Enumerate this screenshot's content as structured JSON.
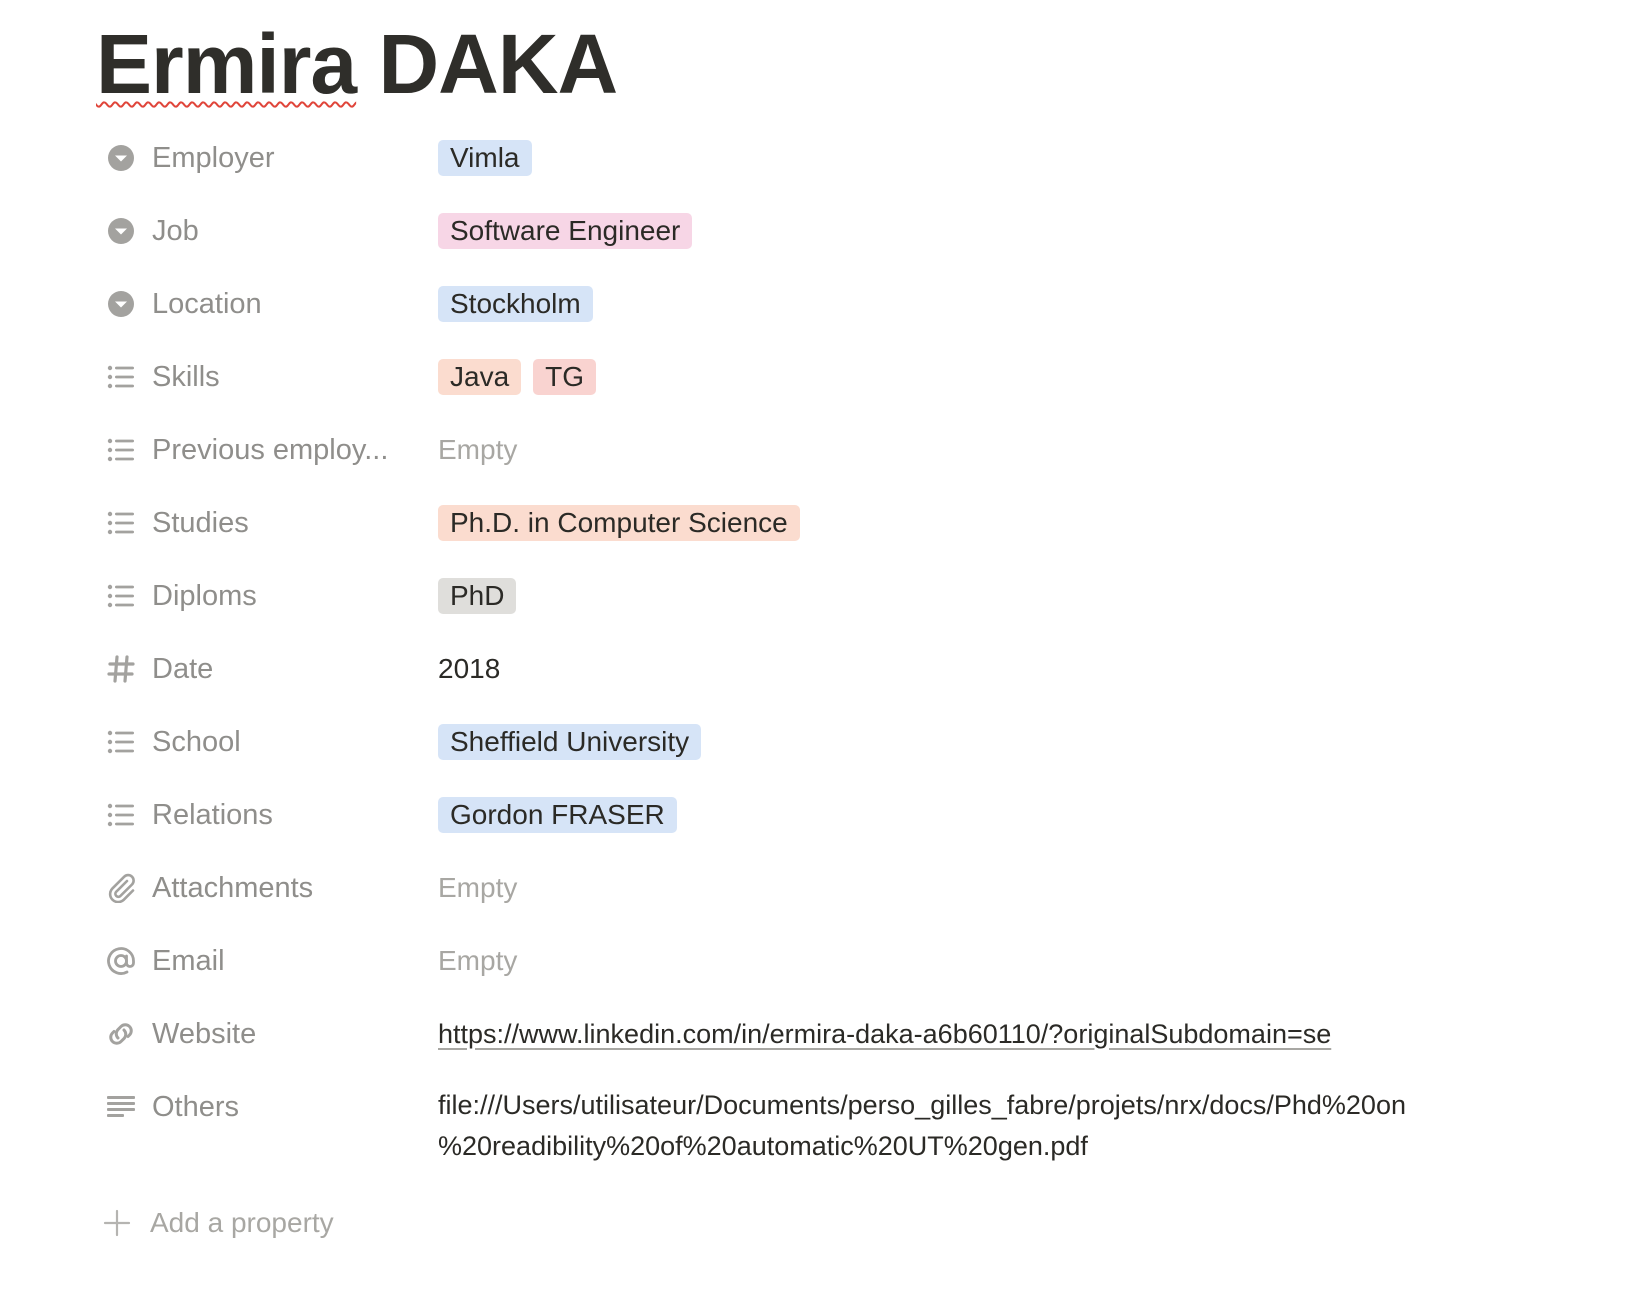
{
  "page": {
    "title_first": "Ermira",
    "title_last": "DAKA"
  },
  "properties": [
    {
      "name": "Employer",
      "icon": "select-icon",
      "type": "tags",
      "values": [
        {
          "text": "Vimla",
          "color": "blue"
        }
      ]
    },
    {
      "name": "Job",
      "icon": "select-icon",
      "type": "tags",
      "values": [
        {
          "text": "Software Engineer",
          "color": "pink"
        }
      ]
    },
    {
      "name": "Location",
      "icon": "select-icon",
      "type": "tags",
      "values": [
        {
          "text": "Stockholm",
          "color": "blue"
        }
      ]
    },
    {
      "name": "Skills",
      "icon": "multi-select-icon",
      "type": "tags",
      "values": [
        {
          "text": "Java",
          "color": "orange"
        },
        {
          "text": "TG",
          "color": "red"
        }
      ]
    },
    {
      "name": "Previous employ...",
      "icon": "multi-select-icon",
      "type": "empty",
      "empty_text": "Empty"
    },
    {
      "name": "Studies",
      "icon": "multi-select-icon",
      "type": "tags",
      "values": [
        {
          "text": "Ph.D. in Computer Science",
          "color": "orange"
        }
      ]
    },
    {
      "name": "Diploms",
      "icon": "multi-select-icon",
      "type": "tags",
      "values": [
        {
          "text": "PhD",
          "color": "gray"
        }
      ]
    },
    {
      "name": "Date",
      "icon": "number-icon",
      "type": "text",
      "text": "2018"
    },
    {
      "name": "School",
      "icon": "multi-select-icon",
      "type": "tags",
      "values": [
        {
          "text": "Sheffield University",
          "color": "blue"
        }
      ]
    },
    {
      "name": "Relations",
      "icon": "multi-select-icon",
      "type": "tags",
      "values": [
        {
          "text": "Gordon FRASER",
          "color": "blue"
        }
      ]
    },
    {
      "name": "Attachments",
      "icon": "paperclip-icon",
      "type": "empty",
      "empty_text": "Empty"
    },
    {
      "name": "Email",
      "icon": "at-sign-icon",
      "type": "empty",
      "empty_text": "Empty"
    },
    {
      "name": "Website",
      "icon": "link-icon",
      "type": "link",
      "text": "https://www.linkedin.com/in/ermira-daka-a6b60110/?originalSubdomain=se"
    },
    {
      "name": "Others",
      "icon": "text-lines-icon",
      "type": "multiline",
      "line1": "file:///Users/utilisateur/Documents/perso_gilles_fabre/projets/nrx/docs/Phd%20on",
      "line2": "%20readibility%20of%20automatic%20UT%20gen.pdf"
    }
  ],
  "add_property": {
    "label": "Add a property",
    "icon": "plus-icon"
  },
  "colors": {
    "blue": "#d6e4f7",
    "pink": "#f7d6e6",
    "orange": "#fbdccf",
    "red": "#f9d3d0",
    "gray": "#dfdedb",
    "icon": "#a3a29f",
    "label": "#8f8e8b"
  }
}
